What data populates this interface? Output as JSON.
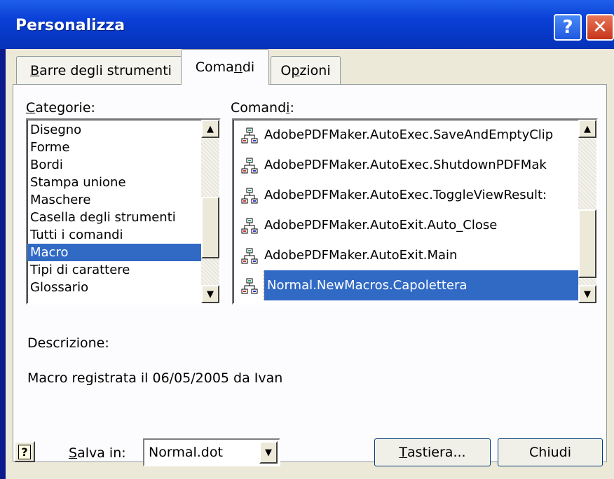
{
  "window": {
    "title": "Personalizza",
    "help_glyph": "?",
    "close_glyph": "✕"
  },
  "tabs": [
    {
      "label": "Barre degli strumenti",
      "active": false
    },
    {
      "label": "Comandi",
      "active": true
    },
    {
      "label": "Opzioni",
      "active": false
    }
  ],
  "categories": {
    "label": "Categorie:",
    "items": [
      "Disegno",
      "Forme",
      "Bordi",
      "Stampa unione",
      "Maschere",
      "Casella degli strumenti",
      "Tutti i comandi",
      "Macro",
      "Tipi di carattere",
      "Glossario"
    ],
    "selected": "Macro"
  },
  "commands": {
    "label": "Comandi:",
    "items": [
      "AdobePDFMaker.AutoExec.SaveAndEmptyClip",
      "AdobePDFMaker.AutoExec.ShutdownPDFMak",
      "AdobePDFMaker.AutoExec.ToggleViewResult:",
      "AdobePDFMaker.AutoExit.Auto_Close",
      "AdobePDFMaker.AutoExit.Main",
      "Normal.NewMacros.Capolettera"
    ],
    "selected": "Normal.NewMacros.Capolettera",
    "icon": "macro-icon"
  },
  "description": {
    "label": "Descrizione:",
    "text": "Macro registrata il 06/05/2005 da Ivan"
  },
  "footer": {
    "save_in_label": "Salva in:",
    "save_in_value": "Normal.dot",
    "keyboard_button": "Tastiera...",
    "close_button": "Chiudi"
  },
  "colors": {
    "selection": "#316ac5",
    "titlebar": "#0a3fd6",
    "dialog_bg": "#ece9d8"
  }
}
